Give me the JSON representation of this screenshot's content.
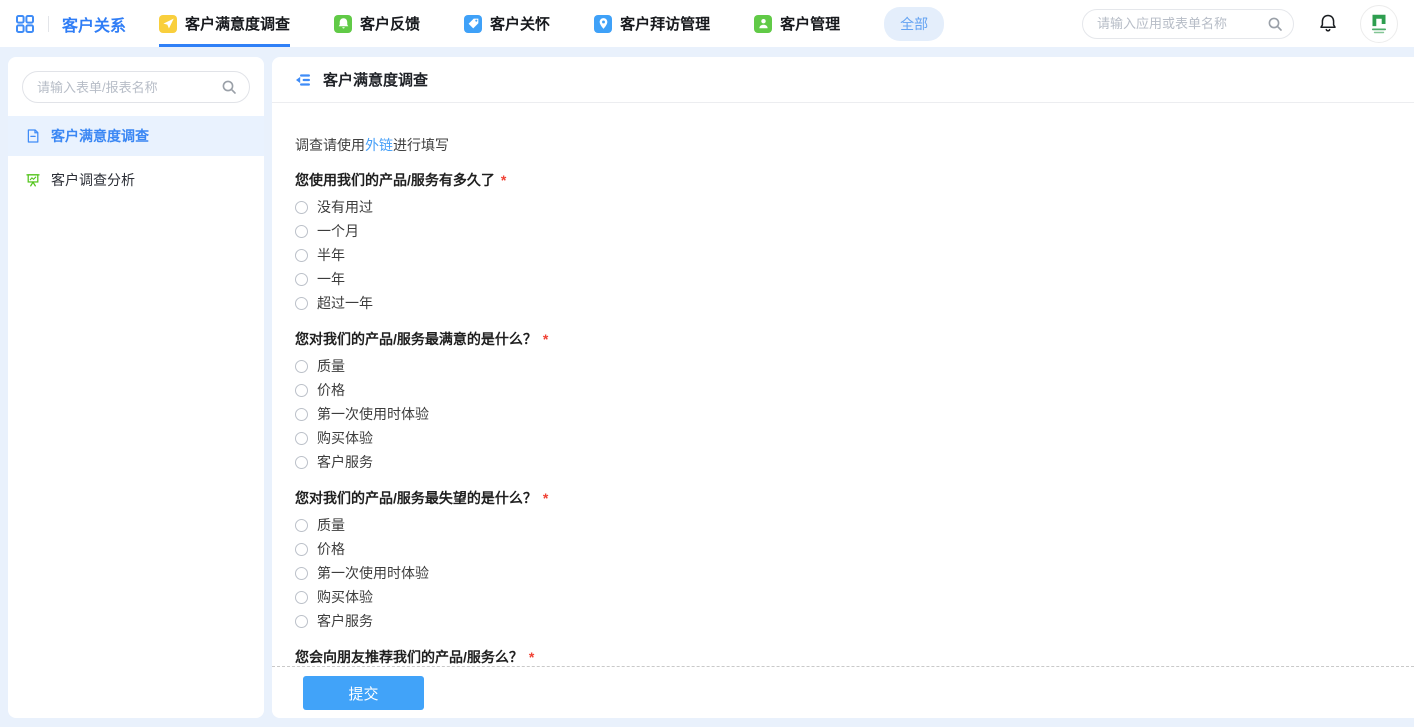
{
  "topbar": {
    "workspace": "客户关系",
    "tabs": [
      {
        "id": "satisfaction-survey",
        "label": "客户满意度调查",
        "icon": "send-icon",
        "color": "#f9cf3d",
        "active": true
      },
      {
        "id": "customer-feedback",
        "label": "客户反馈",
        "icon": "bell-icon",
        "color": "#61ca47",
        "active": false
      },
      {
        "id": "customer-care",
        "label": "客户关怀",
        "icon": "tag-icon",
        "color": "#3fa1f8",
        "active": false
      },
      {
        "id": "visit-management",
        "label": "客户拜访管理",
        "icon": "location-icon",
        "color": "#3fa1f8",
        "active": false
      },
      {
        "id": "customer-management",
        "label": "客户管理",
        "icon": "user-icon",
        "color": "#61ca47",
        "active": false
      }
    ],
    "all_pill": "全部",
    "search_placeholder": "请输入应用或表单名称"
  },
  "sidebar": {
    "search_placeholder": "请输入表单/报表名称",
    "items": [
      {
        "id": "satisfaction-survey-form",
        "label": "客户满意度调查",
        "icon": "form-icon",
        "active": true
      },
      {
        "id": "survey-analysis",
        "label": "客户调查分析",
        "icon": "report-icon",
        "active": false
      }
    ]
  },
  "main": {
    "title": "客户满意度调查",
    "intro": {
      "prefix": "调查请使用",
      "link": "外链",
      "suffix": "进行填写"
    },
    "required_mark": "*",
    "questions": [
      {
        "title": "您使用我们的产品/服务有多久了",
        "required": true,
        "options": [
          "没有用过",
          "一个月",
          "半年",
          "一年",
          "超过一年"
        ]
      },
      {
        "title": "您对我们的产品/服务最满意的是什么？",
        "required": true,
        "options": [
          "质量",
          "价格",
          "第一次使用时体验",
          "购买体验",
          "客户服务"
        ]
      },
      {
        "title": "您对我们的产品/服务最失望的是什么？",
        "required": true,
        "options": [
          "质量",
          "价格",
          "第一次使用时体验",
          "购买体验",
          "客户服务"
        ]
      },
      {
        "title": "您会向朋友推荐我们的产品/服务么？",
        "required": true,
        "options": []
      }
    ],
    "submit_label": "提交"
  },
  "colors": {
    "brand": "#2f7df6",
    "underline": "#2f80f7",
    "link": "#459ff8",
    "submit": "#41a3f9",
    "pageBg": "#e9f1fc",
    "selectedBg": "#e9f2fe",
    "required": "#f04134",
    "pillBg": "#e4eefb",
    "pillText": "#64a3f2"
  }
}
